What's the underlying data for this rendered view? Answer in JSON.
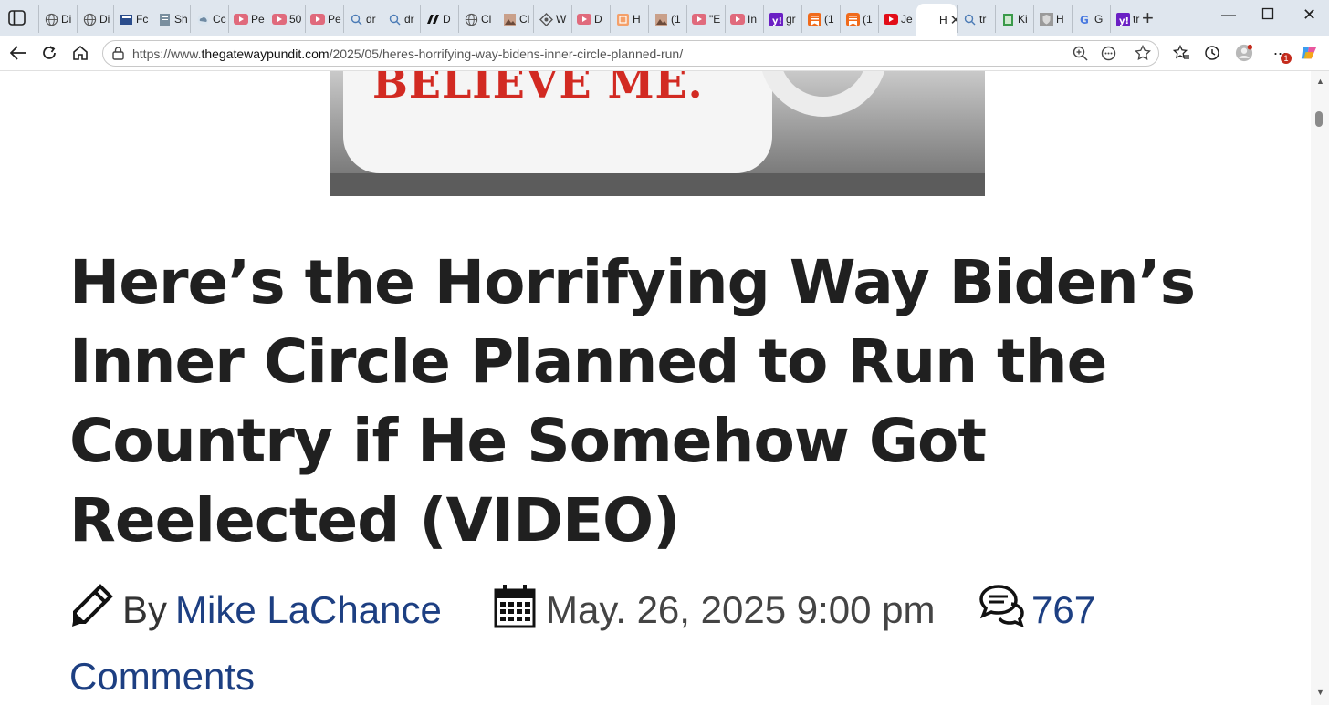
{
  "browser": {
    "tabs": [
      {
        "label": "Di",
        "icon": "globe-icon"
      },
      {
        "label": "Di",
        "icon": "globe-icon"
      },
      {
        "label": "Fc",
        "icon": "news-icon"
      },
      {
        "label": "Sh",
        "icon": "doc-icon"
      },
      {
        "label": "Cc",
        "icon": "cloud-icon"
      },
      {
        "label": "Pe",
        "icon": "youtube-icon"
      },
      {
        "label": "50",
        "icon": "youtube-icon"
      },
      {
        "label": "Pe",
        "icon": "youtube-icon"
      },
      {
        "label": "dr",
        "icon": "search-icon"
      },
      {
        "label": "dr",
        "icon": "search-icon"
      },
      {
        "label": "D",
        "icon": "logo-icon"
      },
      {
        "label": "Cl",
        "icon": "globe-icon"
      },
      {
        "label": "Cl",
        "icon": "image-icon"
      },
      {
        "label": "W",
        "icon": "diamond-icon"
      },
      {
        "label": "D",
        "icon": "youtube-icon"
      },
      {
        "label": "H",
        "icon": "bookmark-icon"
      },
      {
        "label": "(1",
        "icon": "image-icon"
      },
      {
        "label": "\"E",
        "icon": "youtube-icon"
      },
      {
        "label": "In",
        "icon": "youtube-icon"
      },
      {
        "label": "gr",
        "icon": "yahoo-icon"
      },
      {
        "label": "(1",
        "icon": "substack-icon"
      },
      {
        "label": "(1",
        "icon": "substack-icon"
      },
      {
        "label": "Je",
        "icon": "youtube-red-icon"
      },
      {
        "label": "H",
        "icon": "page-icon",
        "active": true
      },
      {
        "label": "tr",
        "icon": "search-icon"
      },
      {
        "label": "Ki",
        "icon": "sheet-icon"
      },
      {
        "label": "H",
        "icon": "shield-icon"
      },
      {
        "label": "G",
        "icon": "google-icon"
      },
      {
        "label": "tr",
        "icon": "yahoo-icon"
      }
    ],
    "url_prefix": "https://www.",
    "url_domain": "thegatewaypundit.com",
    "url_path": "/2025/05/heres-horrifying-way-bidens-inner-circle-planned-run/",
    "notification_badge": "1",
    "colors": {
      "accent": "#1d3f82",
      "tabstrip": "#dfe6ee",
      "heading": "#202020"
    }
  },
  "article": {
    "hero_text": "BELIEVE ME.",
    "headline": "Here’s the Horrifying Way Biden’s Inner Circle Planned to Run the Country if He Somehow Got Reelected (VIDEO)",
    "by_label": "By",
    "author": "Mike LaChance",
    "date": "May. 26, 2025 9:00 pm",
    "comments_count": "767",
    "comments_label": "Comments"
  }
}
